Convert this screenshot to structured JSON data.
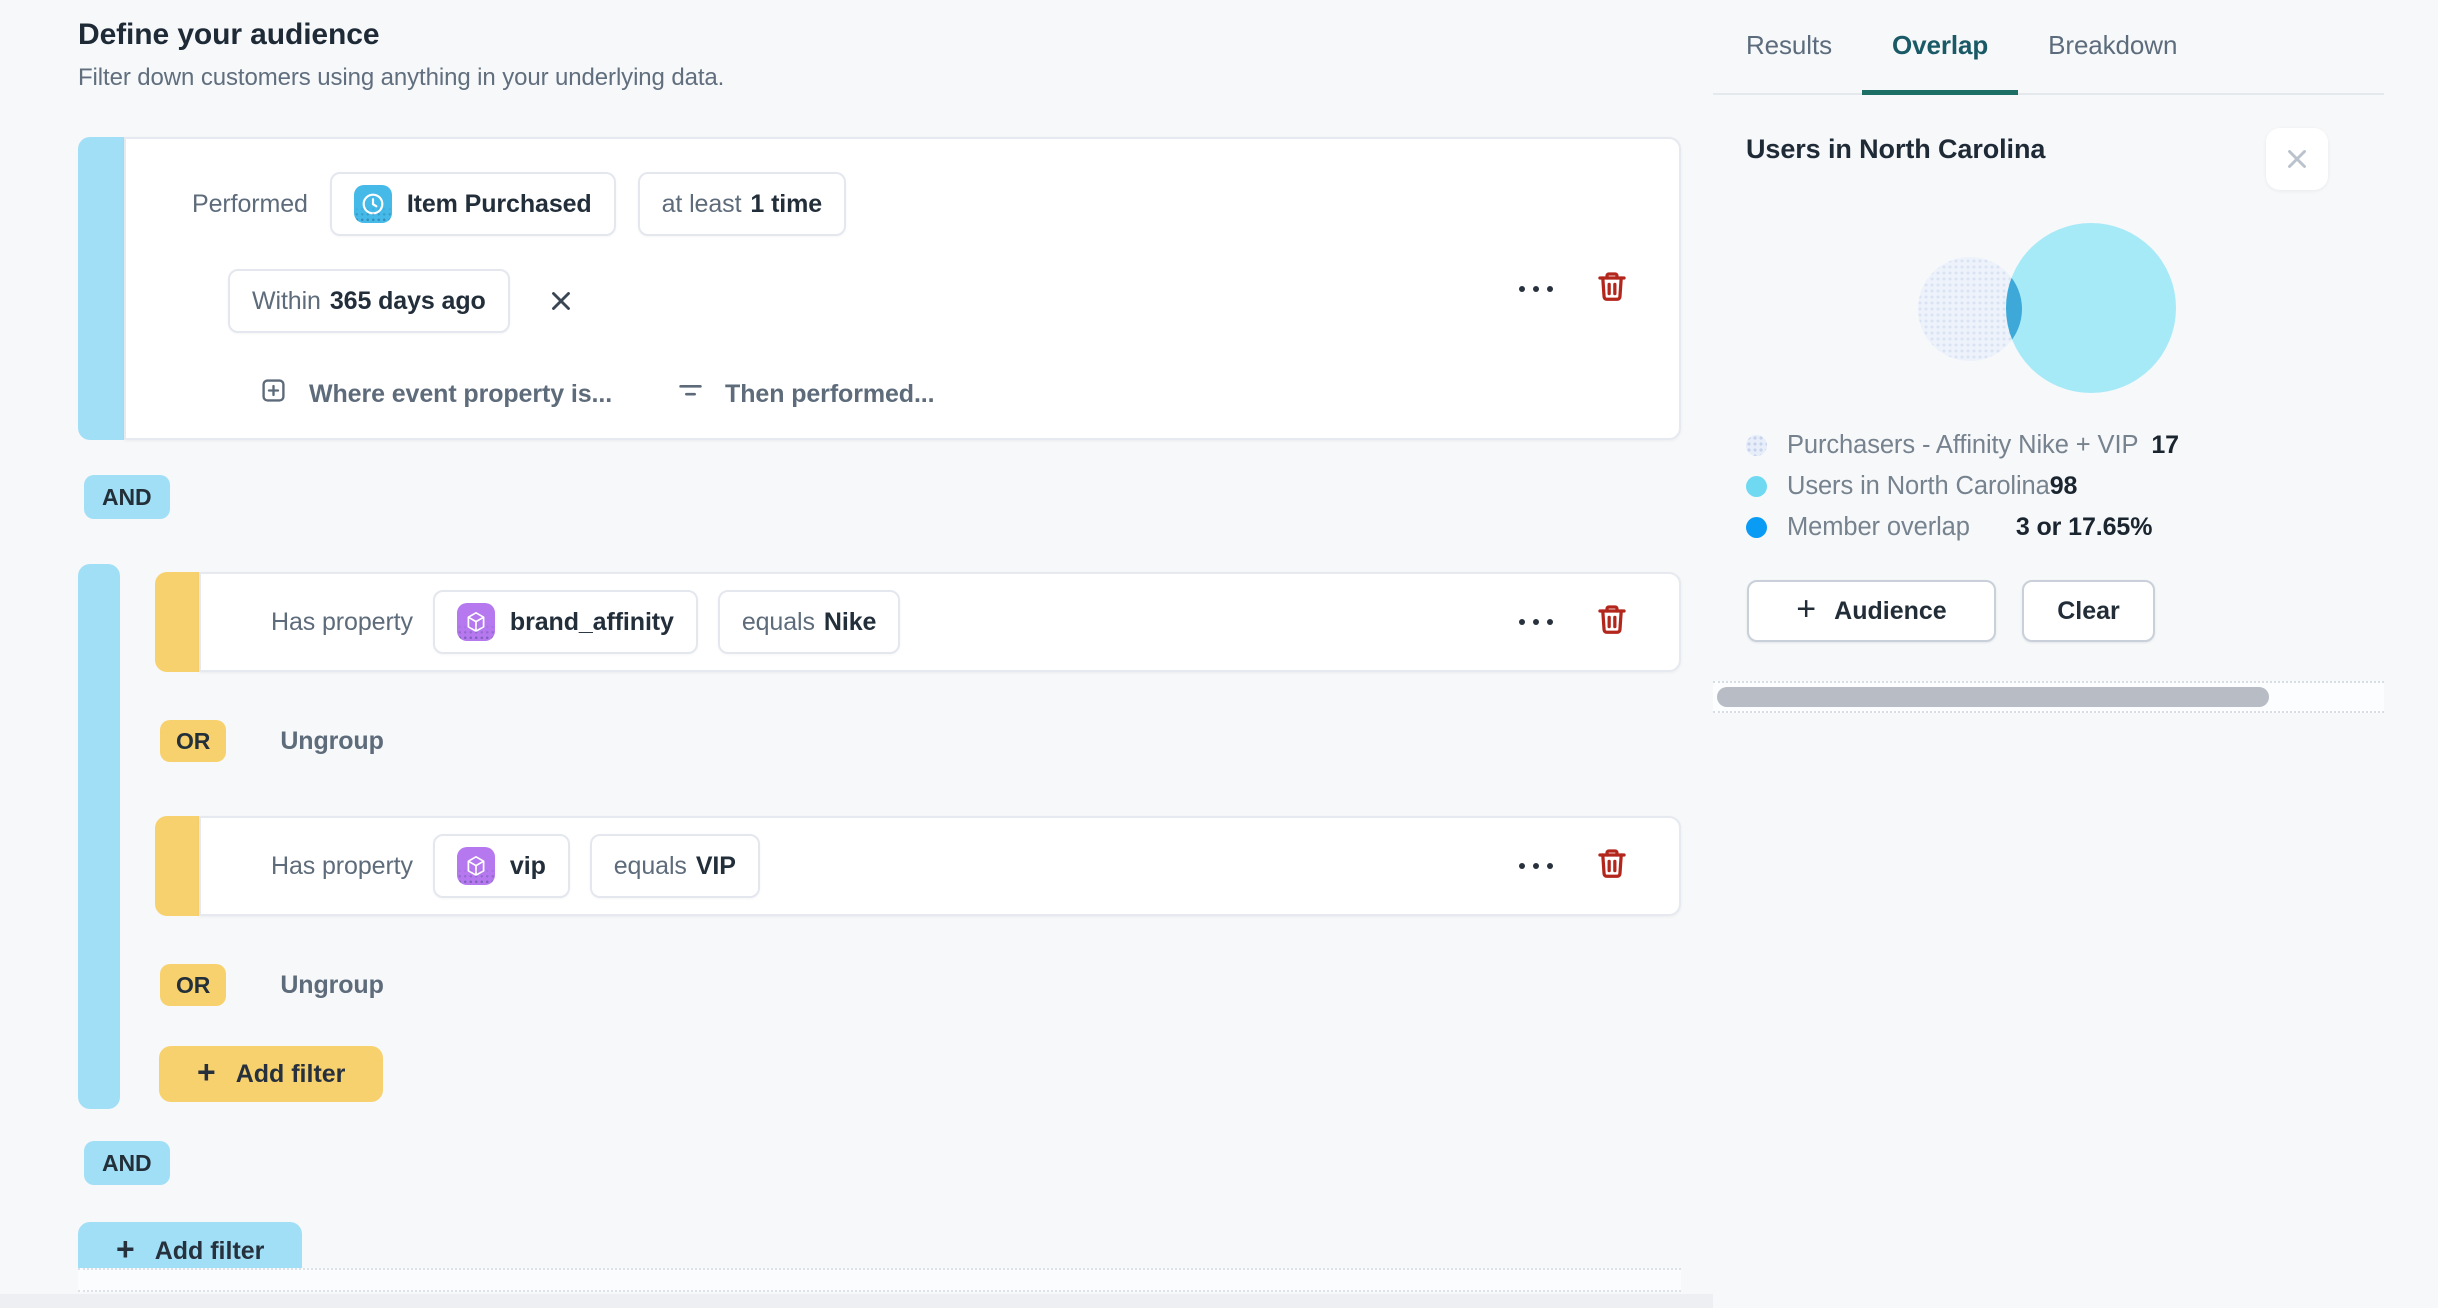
{
  "header": {
    "title": "Define your audience",
    "subtitle": "Filter down customers using anything in your underlying data."
  },
  "event_filter": {
    "verb": "Performed",
    "event": {
      "icon": "clock-icon",
      "name": "Item Purchased"
    },
    "frequency": {
      "prefix": "at least",
      "value": "1 time"
    },
    "window": {
      "prefix": "Within",
      "value": "365 days ago"
    },
    "actions": [
      {
        "icon": "plus-square-icon",
        "label": "Where event property is..."
      },
      {
        "icon": "filter-icon",
        "label": "Then performed..."
      }
    ]
  },
  "groups": {
    "and_label": "AND",
    "or_label": "OR",
    "ungroup_label": "Ungroup",
    "add_filter_label": "Add filter"
  },
  "property_filters": [
    {
      "verb": "Has property",
      "icon": "cube-icon",
      "property": "brand_affinity",
      "operator": "equals",
      "value": "Nike"
    },
    {
      "verb": "Has property",
      "icon": "cube-icon",
      "property": "vip",
      "operator": "equals",
      "value": "VIP"
    }
  ],
  "sidebar": {
    "tabs": [
      {
        "label": "Results",
        "active": false
      },
      {
        "label": "Overlap",
        "active": true
      },
      {
        "label": "Breakdown",
        "active": false
      }
    ],
    "panel_title": "Users in North Carolina",
    "legend": [
      {
        "label": "Purchasers - Affinity Nike + VIP",
        "value": "17"
      },
      {
        "label": "Users in North Carolina",
        "value": "98"
      },
      {
        "label": "Member overlap",
        "value": "3 or 17.65%"
      }
    ],
    "venn": {
      "type": "venn",
      "sets": [
        {
          "label": "Purchasers - Affinity Nike + VIP",
          "size": 17,
          "color": "#EDF2FB"
        },
        {
          "label": "Users in North Carolina",
          "size": 98,
          "color": "#A6EAF8"
        }
      ],
      "overlap": {
        "label": "Member overlap",
        "size": 3,
        "percent": "17.65%",
        "color": "#3EA8D8"
      }
    },
    "buttons": {
      "audience": "Audience",
      "clear": "Clear"
    }
  },
  "colors": {
    "accent_blue": "#A1DFF7",
    "accent_yellow": "#F8D16F",
    "event_icon_bg": "#45BAE9",
    "property_icon_bg": "#B678EF",
    "danger_red": "#B3261C",
    "tab_active_underline": "#1D6F66",
    "legend_dots": [
      "#E7EDF9",
      "#6FD9F2",
      "#0A9BF5"
    ]
  }
}
